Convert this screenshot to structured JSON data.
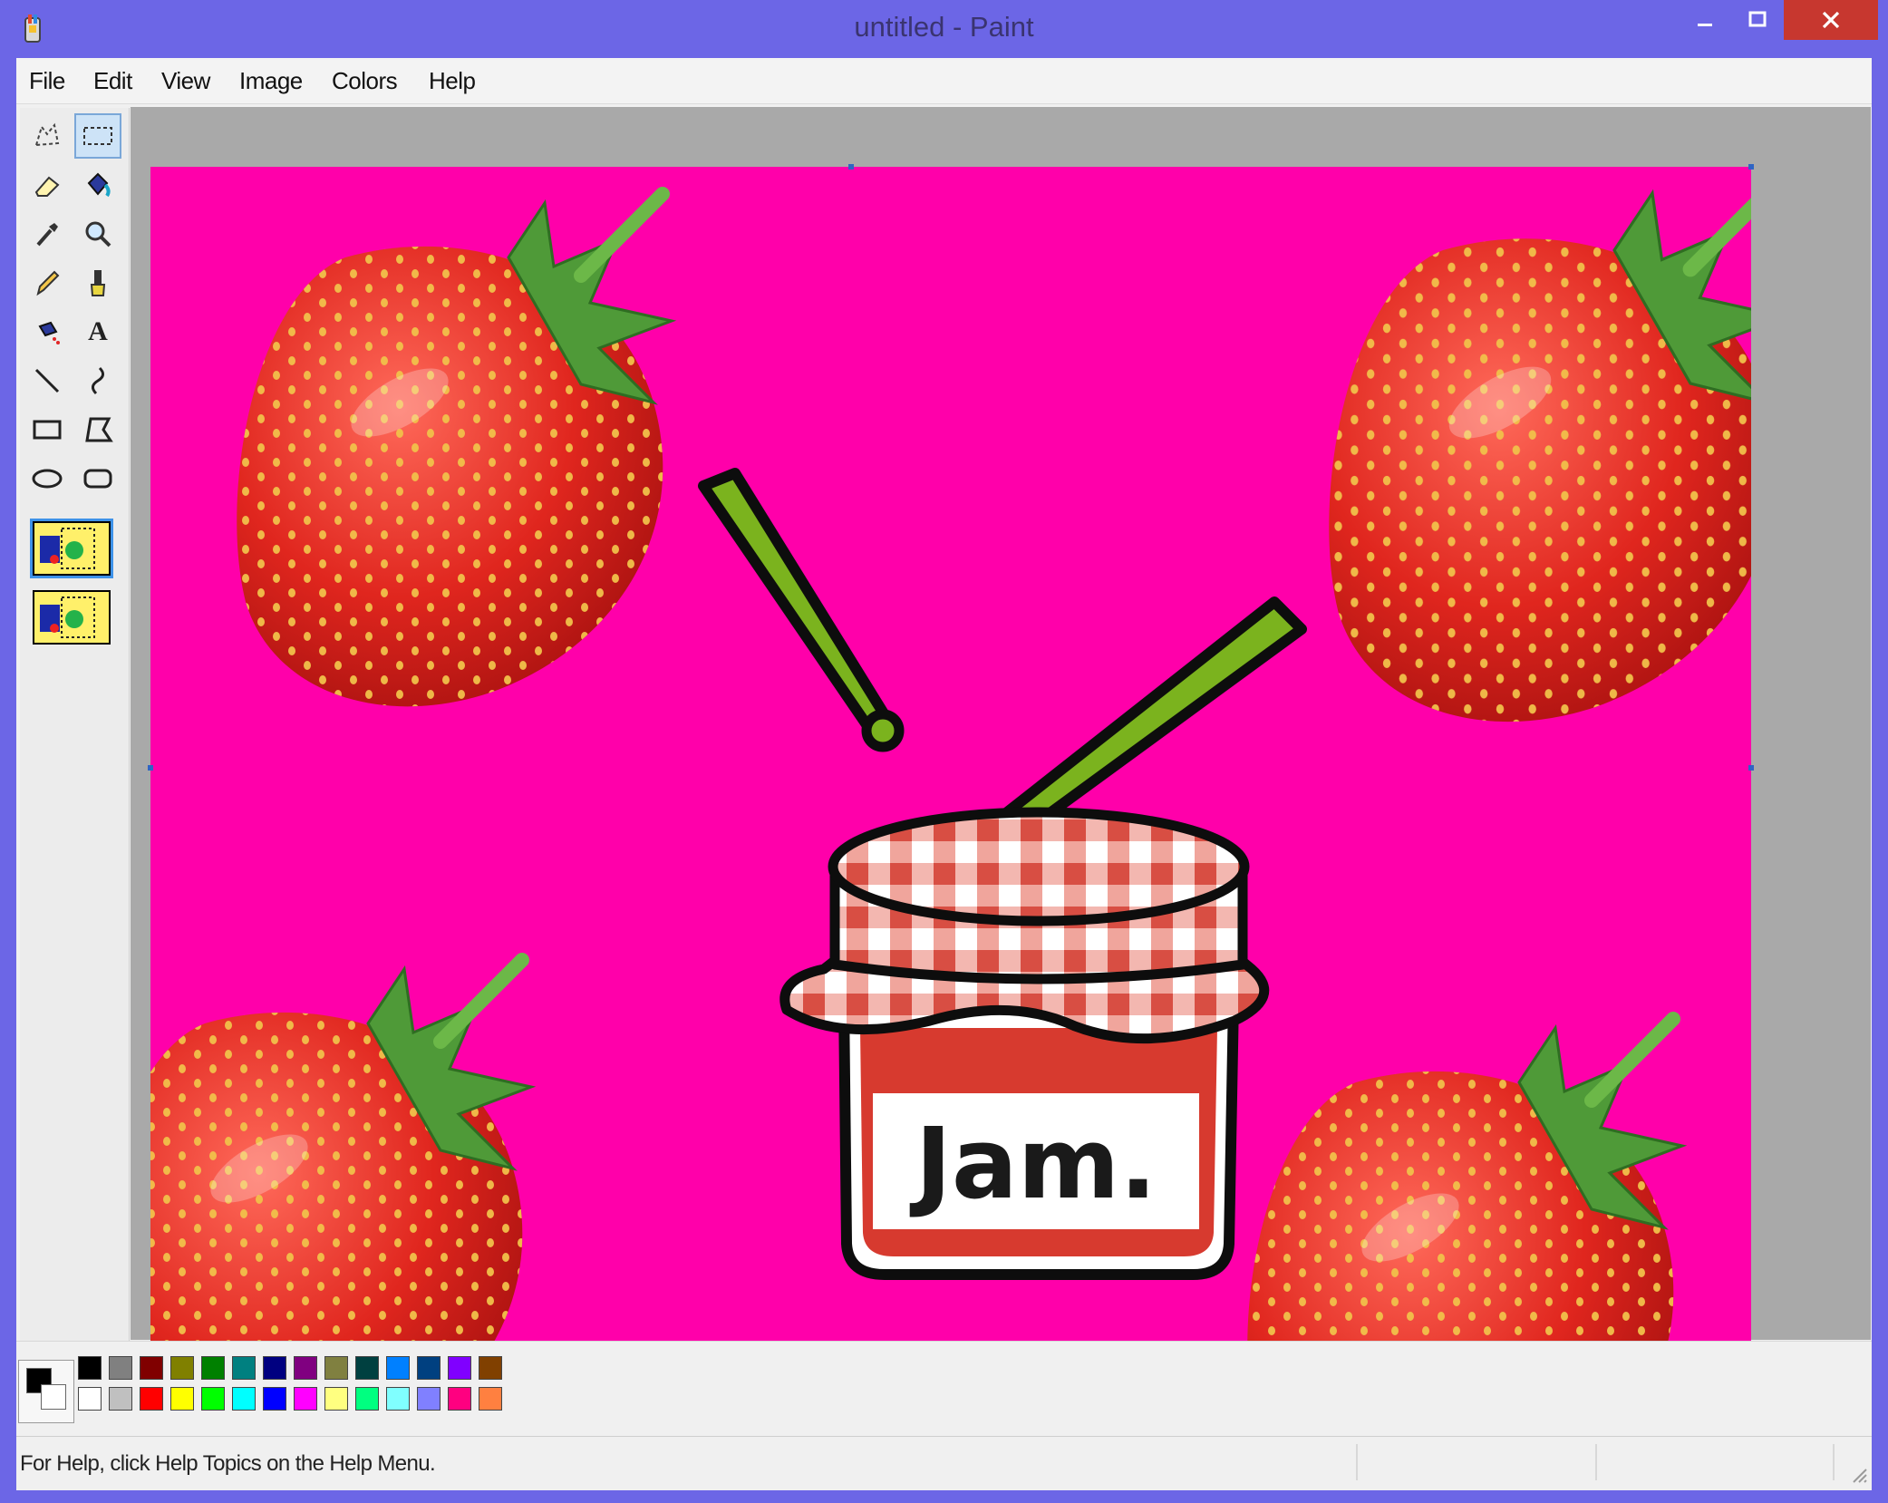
{
  "window": {
    "title": "untitled - Paint",
    "controls": {
      "minimize": "–",
      "maximize": "□",
      "close": "✕"
    }
  },
  "menu": {
    "items": [
      "File",
      "Edit",
      "View",
      "Image",
      "Colors",
      "Help"
    ]
  },
  "tools": [
    {
      "name": "free-form-select-icon"
    },
    {
      "name": "rectangle-select-icon",
      "active": true
    },
    {
      "name": "eraser-icon"
    },
    {
      "name": "fill-bucket-icon"
    },
    {
      "name": "pick-color-icon"
    },
    {
      "name": "magnifier-icon"
    },
    {
      "name": "pencil-icon"
    },
    {
      "name": "brush-icon"
    },
    {
      "name": "airbrush-icon"
    },
    {
      "name": "text-icon",
      "glyph": "A"
    },
    {
      "name": "line-icon"
    },
    {
      "name": "curve-icon"
    },
    {
      "name": "rectangle-icon"
    },
    {
      "name": "polygon-icon"
    },
    {
      "name": "ellipse-icon"
    },
    {
      "name": "rounded-rectangle-icon"
    }
  ],
  "canvas": {
    "background": "#ff00aa",
    "label_text": "Jam."
  },
  "palette": {
    "foreground": "#000000",
    "background": "#ffffff",
    "row1": [
      "#000000",
      "#808080",
      "#800000",
      "#808000",
      "#008000",
      "#008080",
      "#000080",
      "#800080",
      "#808040",
      "#004040",
      "#0080ff",
      "#004080",
      "#8000ff",
      "#804000"
    ],
    "row2": [
      "#ffffff",
      "#c0c0c0",
      "#ff0000",
      "#ffff00",
      "#00ff00",
      "#00ffff",
      "#0000ff",
      "#ff00ff",
      "#ffff80",
      "#00ff80",
      "#80ffff",
      "#8080ff",
      "#ff0080",
      "#ff8040"
    ]
  },
  "status": {
    "help_text": "For Help, click Help Topics on the Help Menu."
  }
}
